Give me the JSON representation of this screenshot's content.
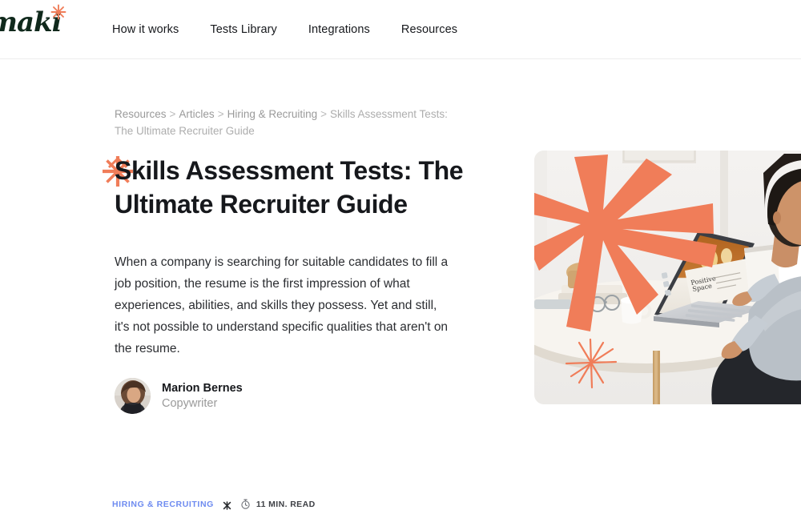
{
  "brand": {
    "logo_text": "maki",
    "logo_star_icon": "asterisk-star-icon",
    "accent_orange": "#F07D59",
    "logo_color": "#10291C",
    "tag_blue": "#6E8BF0"
  },
  "nav": {
    "items": [
      {
        "label": "How it works"
      },
      {
        "label": "Tests Library"
      },
      {
        "label": "Integrations"
      },
      {
        "label": "Resources"
      }
    ]
  },
  "breadcrumb": {
    "items": [
      {
        "label": "Resources"
      },
      {
        "label": "Articles"
      },
      {
        "label": "Hiring & Recruiting"
      }
    ],
    "separator": ">",
    "current": "Skills Assessment Tests: The Ultimate Recruiter Guide"
  },
  "article": {
    "star_icon": "starburst-icon",
    "title": "Skills Assessment Tests: The Ultimate Recruiter Guide",
    "lede": "When a company is searching for suitable candidates to fill a job position, the resume is the first impression of what experiences, abilities, and skills they possess. Yet and still, it's not possible to understand specific qualities that aren't on the resume.",
    "author": {
      "avatar_icon": "author-avatar",
      "name": "Marion Bernes",
      "role": "Copywriter"
    },
    "meta": {
      "tag": "HIRING & RECRUITING",
      "separator_icon": "star-separator-icon",
      "clock_icon": "stopwatch-icon",
      "read_time": "11 MIN. READ"
    }
  },
  "hero": {
    "alt_name": "person-working-on-laptop-at-table",
    "overlay_big_star_icon": "big-starburst-overlay",
    "overlay_small_star_icon": "small-star-outline-overlay",
    "laptop_screen_title": "Positive Space"
  }
}
